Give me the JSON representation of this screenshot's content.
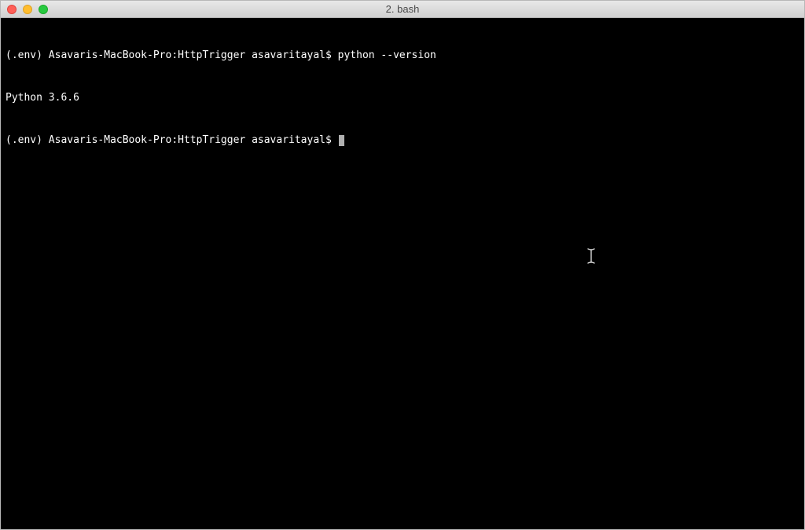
{
  "window": {
    "title": "2. bash"
  },
  "terminal": {
    "prompt1": "(.env) Asavaris-MacBook-Pro:HttpTrigger asavaritayal$ ",
    "command1": "python --version",
    "output1": "Python 3.6.6",
    "prompt2": "(.env) Asavaris-MacBook-Pro:HttpTrigger asavaritayal$ "
  }
}
